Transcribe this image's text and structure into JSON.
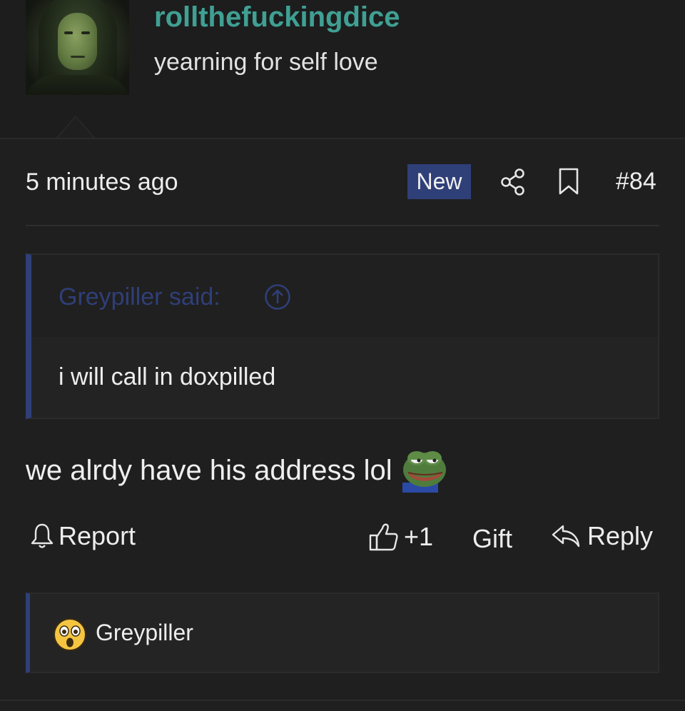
{
  "post": {
    "username": "rollthefuckingdice",
    "user_title": "yearning for self love",
    "time": "5 minutes ago",
    "badge": "New",
    "post_number": "#84",
    "quote": {
      "author_label": "Greypiller said:",
      "text": "i will call in doxpilled"
    },
    "message": "we alrdy have his address lol",
    "actions": {
      "report": "Report",
      "like": "+1",
      "gift": "Gift",
      "reply": "Reply"
    },
    "reactions": {
      "user": "Greypiller"
    }
  },
  "colors": {
    "background": "#1f1f1f",
    "username": "#3fa093",
    "accent_blue": "#2f3f78",
    "text": "#ededed"
  },
  "icons": [
    "share-icon",
    "bookmark-icon",
    "arrow-up-circle-icon",
    "bell-icon",
    "thumbs-up-icon",
    "reply-arrow-icon",
    "astonished-face-icon",
    "pepe-emoji"
  ]
}
